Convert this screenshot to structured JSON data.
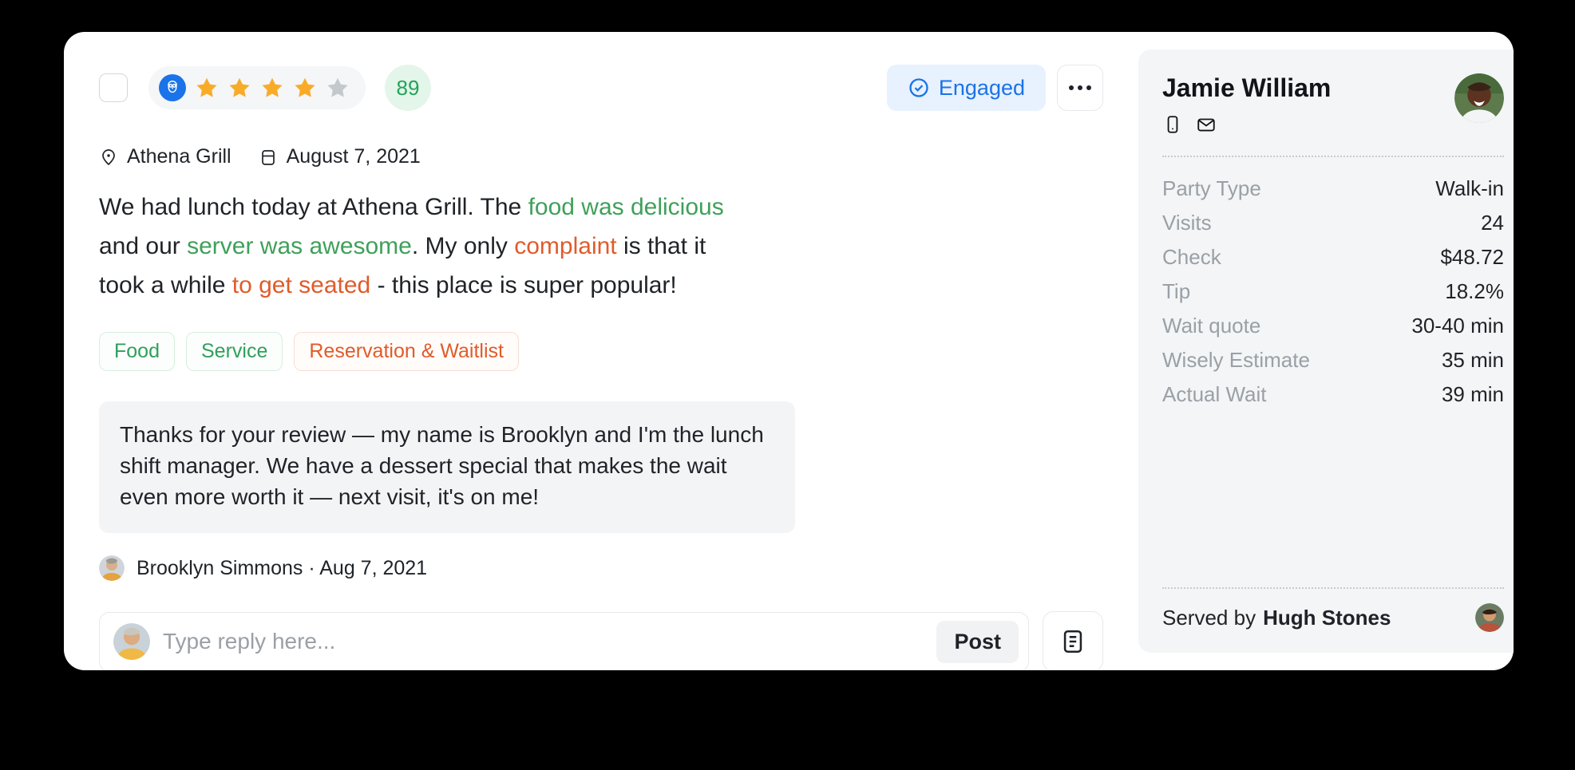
{
  "card": {
    "checkbox_checked": false,
    "source_icon": "owl-logo-icon",
    "rating": {
      "value": 4,
      "max": 5
    },
    "score": "89",
    "status": {
      "label": "Engaged",
      "icon": "check-circle-icon",
      "color": "#1a73e8"
    },
    "more_menu": "ellipsis-icon"
  },
  "meta": {
    "location_icon": "location-pin-icon",
    "location": "Athena Grill",
    "date_icon": "calendar-icon",
    "date": "August 7, 2021"
  },
  "review": {
    "segments": [
      {
        "text": "We had lunch today at Athena Grill. The ",
        "tone": "neutral"
      },
      {
        "text": "food was delicious",
        "tone": "positive"
      },
      {
        "text": " and our ",
        "tone": "neutral"
      },
      {
        "text": "server was awesome",
        "tone": "positive"
      },
      {
        "text": ". My only ",
        "tone": "neutral"
      },
      {
        "text": "complaint",
        "tone": "negative"
      },
      {
        "text": " is that it took a while ",
        "tone": "neutral"
      },
      {
        "text": "to get seated",
        "tone": "negative"
      },
      {
        "text": " - this place is super popular!",
        "tone": "neutral"
      }
    ],
    "tags": [
      {
        "label": "Food",
        "tone": "positive"
      },
      {
        "label": "Service",
        "tone": "positive"
      },
      {
        "label": "Reservation & Waitlist",
        "tone": "negative"
      }
    ]
  },
  "reply": {
    "body": "Thanks for your review — my name is Brooklyn and I'm the lunch shift manager. We have a dessert special that makes the wait even more worth it — next visit, it's on me!",
    "author": "Brooklyn Simmons · Aug 7, 2021",
    "author_avatar": "brooklyn-avatar"
  },
  "composer": {
    "placeholder": "Type reply here...",
    "value": "",
    "post_label": "Post",
    "template_icon": "template-document-icon",
    "user_avatar": "current-user-avatar"
  },
  "guest": {
    "name": "Jamie William",
    "phone_icon": "phone-icon",
    "email_icon": "envelope-icon",
    "avatar": "jamie-william-avatar",
    "details": [
      {
        "label": "Party Type",
        "value": "Walk-in"
      },
      {
        "label": "Visits",
        "value": "24"
      },
      {
        "label": "Check",
        "value": "$48.72"
      },
      {
        "label": "Tip",
        "value": "18.2%"
      },
      {
        "label": "Wait quote",
        "value": "30-40 min"
      },
      {
        "label": "Wisely Estimate",
        "value": "35 min"
      },
      {
        "label": "Actual Wait",
        "value": "39 min"
      }
    ],
    "served_by_prefix": "Served by",
    "served_by_name": "Hugh Stones",
    "server_avatar": "hugh-stones-avatar"
  },
  "colors": {
    "accent_blue": "#1a73e8",
    "positive_green": "#3fa05a",
    "negative_orange": "#e05b2a",
    "score_green": "#22a35a",
    "star_gold": "#f9ab28",
    "star_gray": "#c3c8cd"
  }
}
